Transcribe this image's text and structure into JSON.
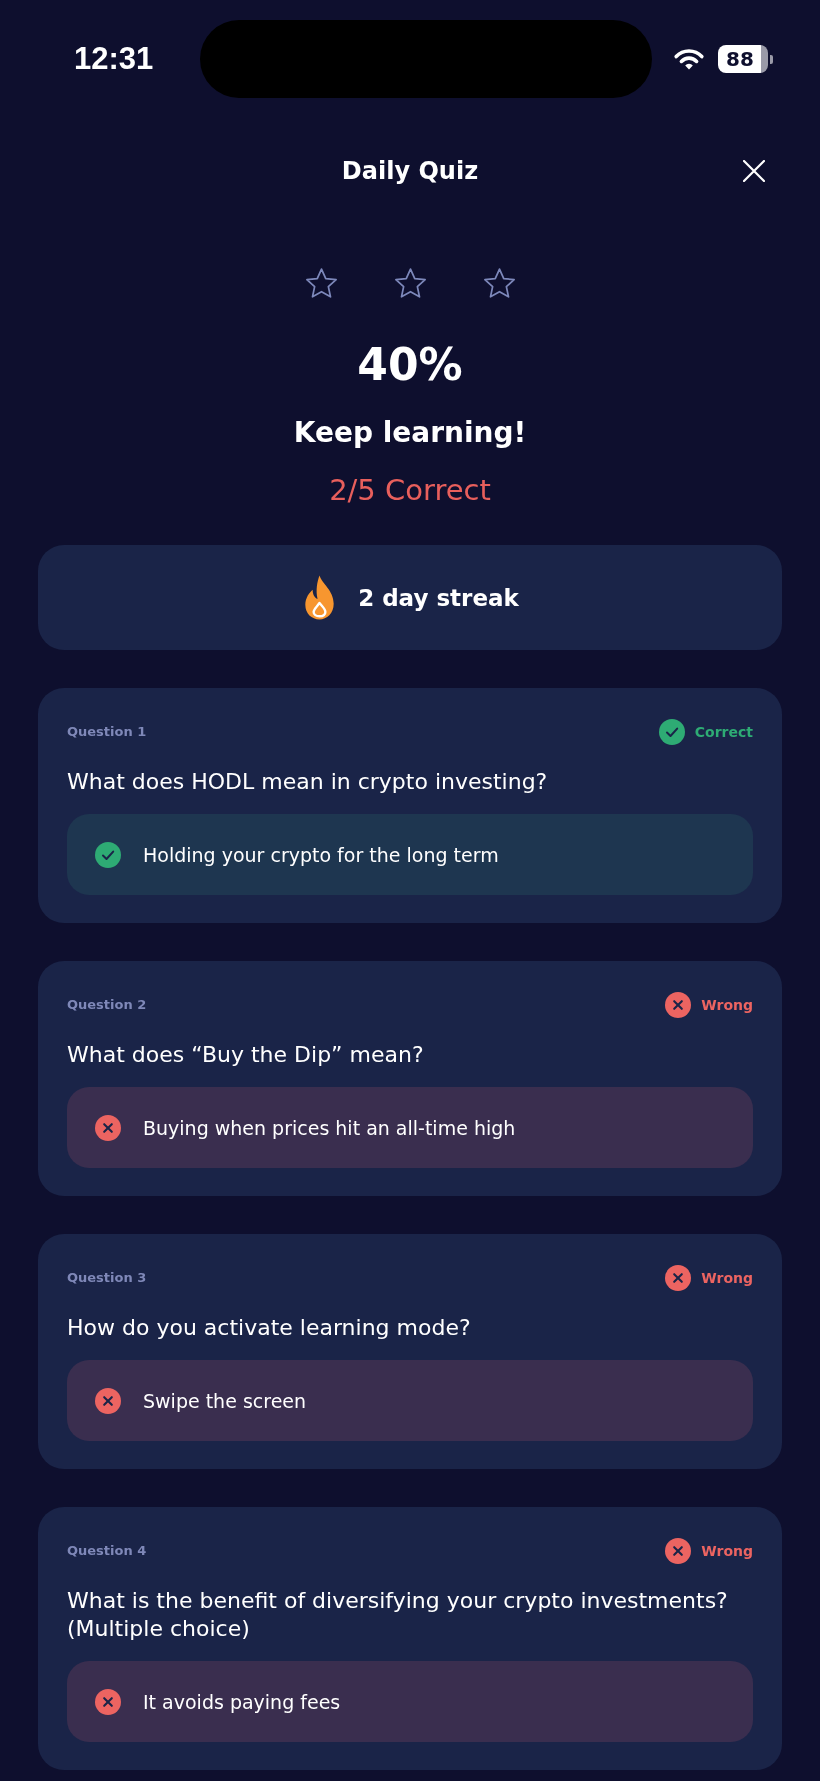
{
  "status_bar": {
    "time": "12:31",
    "battery": "88"
  },
  "header": {
    "title": "Daily Quiz"
  },
  "result": {
    "stars": 0,
    "score": "40%",
    "message": "Keep learning!",
    "summary": "2/5 Correct"
  },
  "streak": {
    "label": "2 day streak"
  },
  "questions": [
    {
      "label": "Question 1",
      "correct": true,
      "status": "Correct",
      "question": "What does HODL mean in crypto investing?",
      "answer": "Holding your crypto for the long term"
    },
    {
      "label": "Question 2",
      "correct": false,
      "status": "Wrong",
      "question": "What does “Buy the Dip” mean?",
      "answer": "Buying when prices hit an all-time high"
    },
    {
      "label": "Question 3",
      "correct": false,
      "status": "Wrong",
      "question": "How do you activate learning mode?",
      "answer": "Swipe the screen"
    },
    {
      "label": "Question 4",
      "correct": false,
      "status": "Wrong",
      "question": "What is the benefit of diversifying your crypto investments? (Multiple choice)",
      "answer": "It avoids paying fees"
    }
  ]
}
